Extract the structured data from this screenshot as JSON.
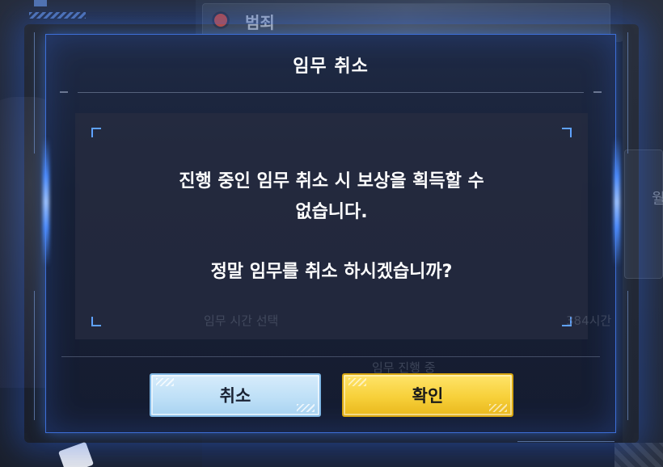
{
  "background": {
    "top_card_label": "범죄",
    "right_edge_text": "월",
    "ghost_left": "임무 시간 선택",
    "ghost_right": "384시간",
    "ghost_bottom": "임무 진행 중"
  },
  "dialog": {
    "title": "임무 취소",
    "message_line1": "진행 중인 임무 취소 시 보상을 획득할 수",
    "message_line2": "없습니다.",
    "question": "정말 임무를 취소 하시겠습니까?",
    "cancel_label": "취소",
    "confirm_label": "확인"
  },
  "colors": {
    "accent_blue": "#3d6fd8",
    "cancel_button": "#bfe0f7",
    "confirm_button": "#f7d03a"
  }
}
